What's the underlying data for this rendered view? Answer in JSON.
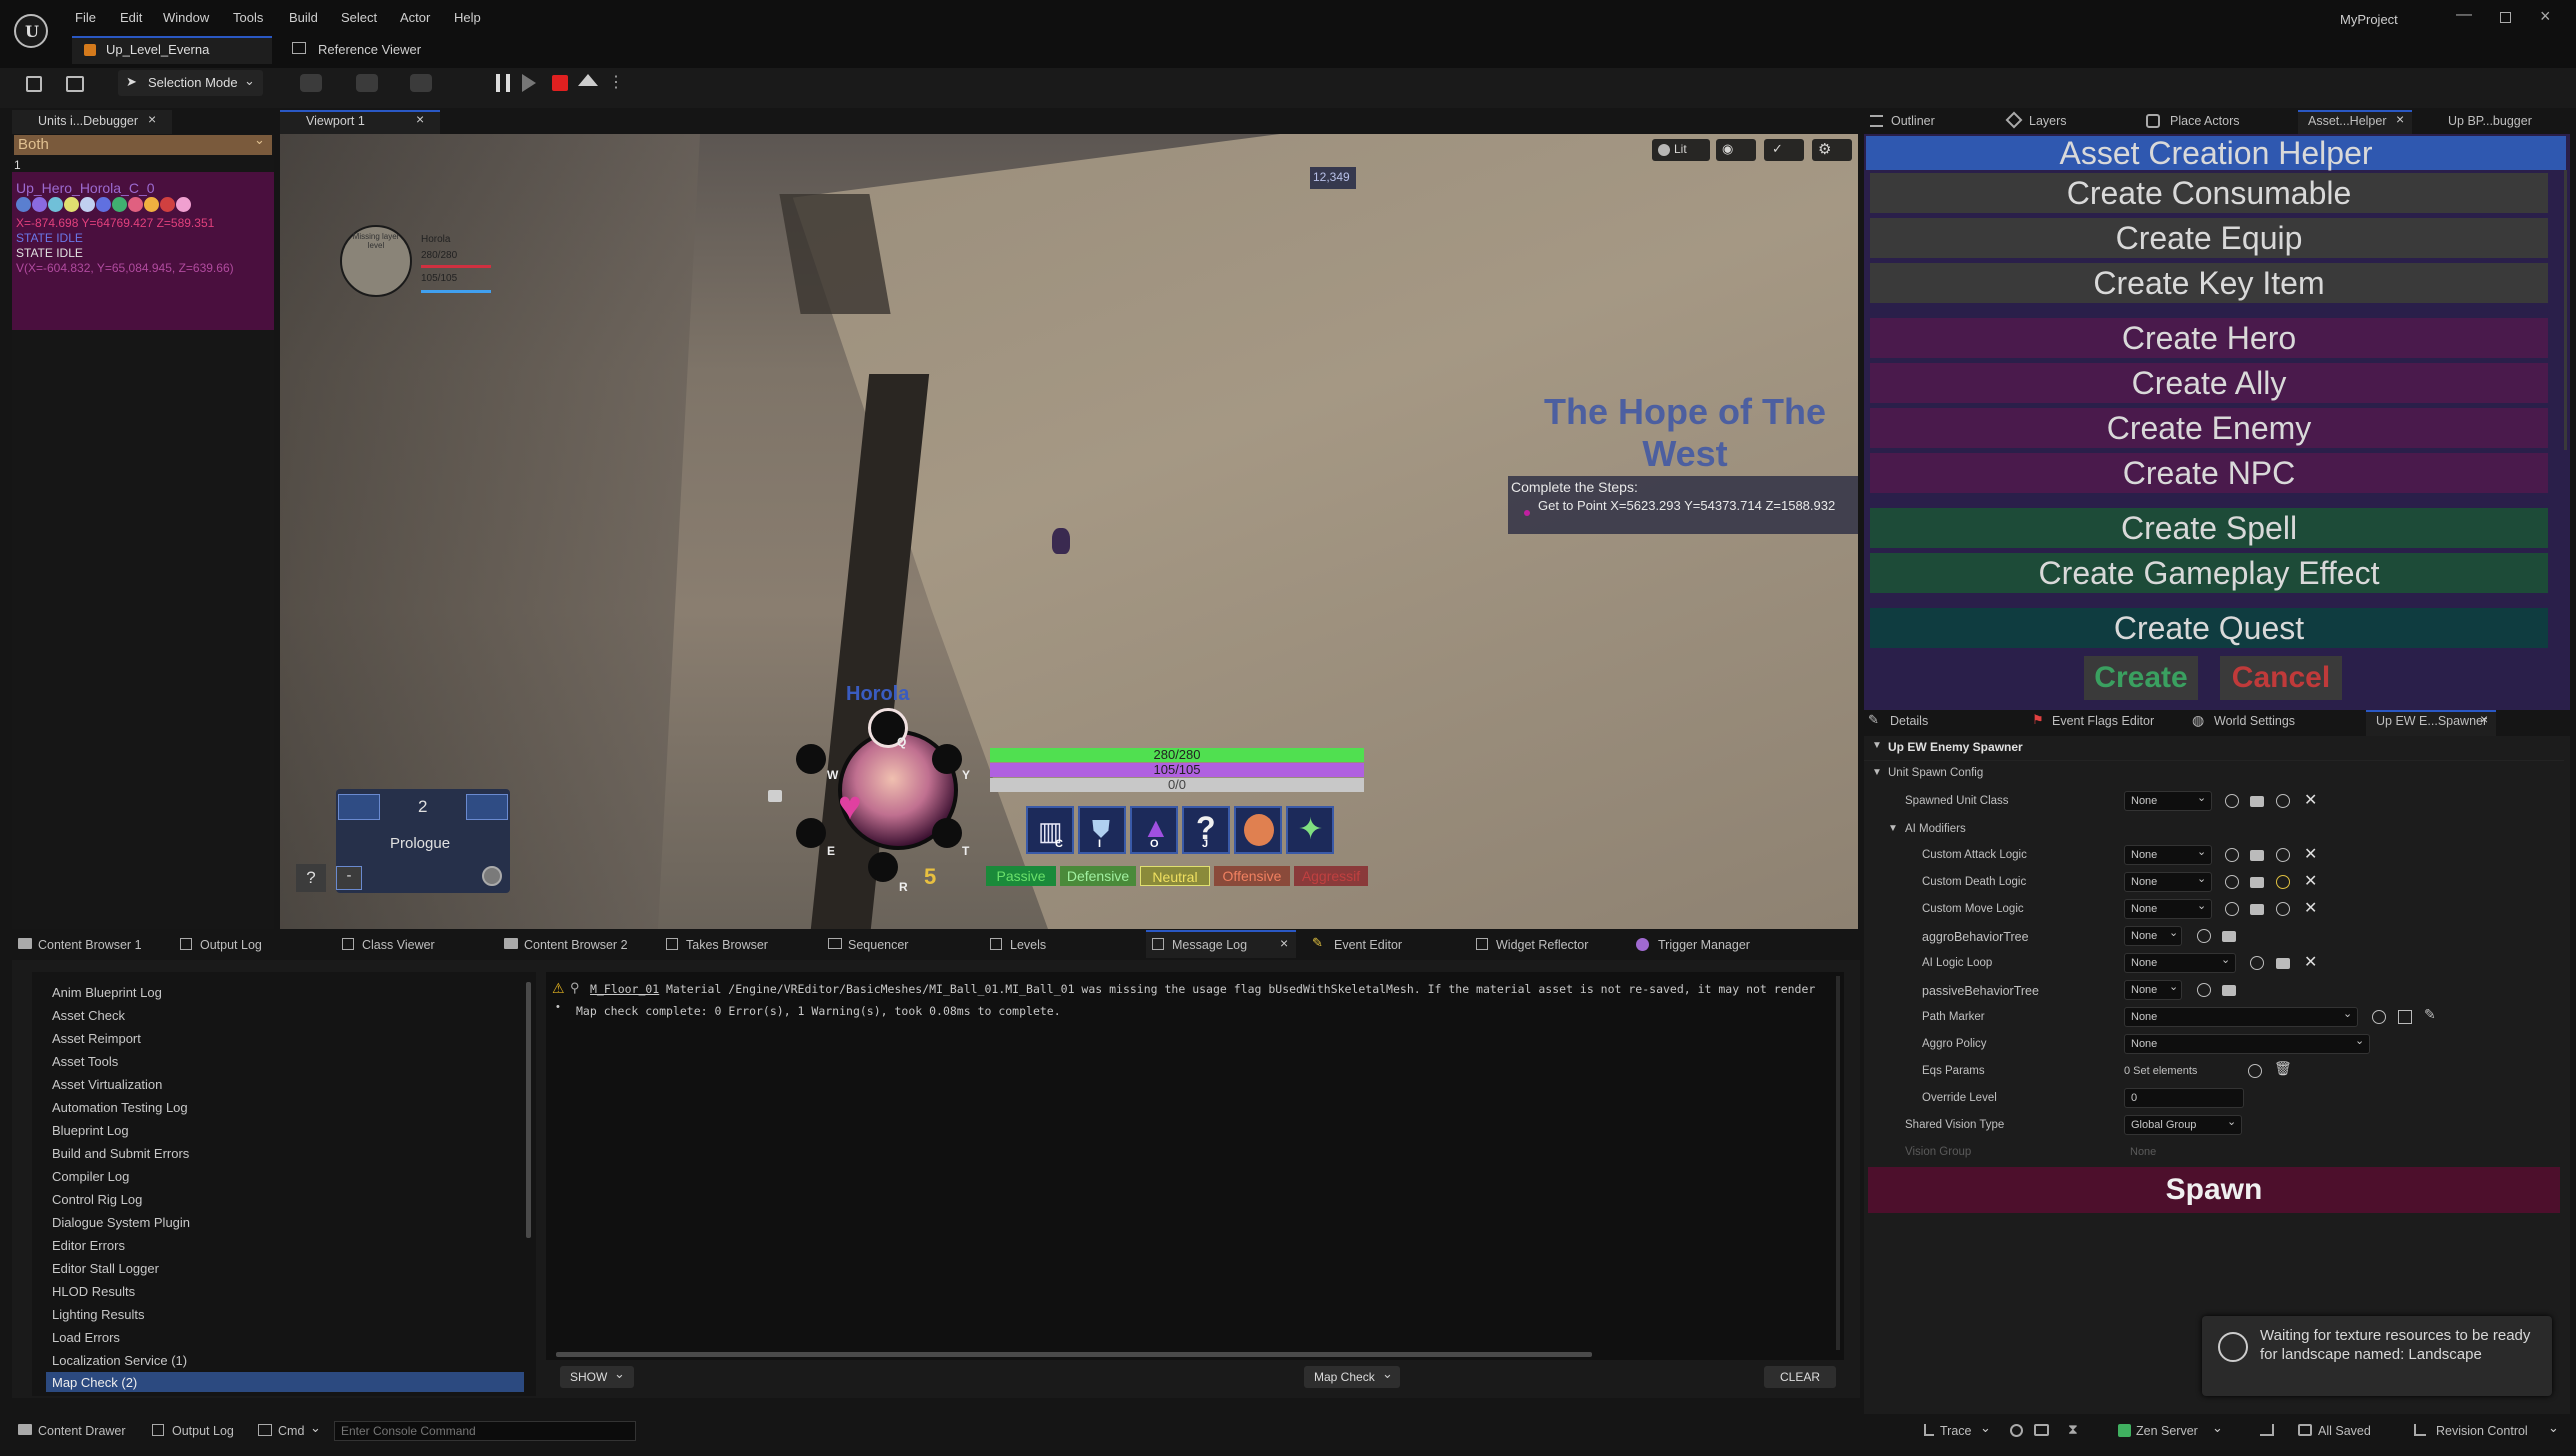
{
  "app": {
    "project_name": "MyProject",
    "level_tab": "Up_Level_Everna",
    "reference_viewer": "Reference Viewer"
  },
  "menu": [
    "File",
    "Edit",
    "Window",
    "Tools",
    "Build",
    "Select",
    "Actor",
    "Help"
  ],
  "toolbar": {
    "selection_mode": "Selection Mode"
  },
  "left_panel": {
    "tab": "Units i...Debugger",
    "filter": "Both",
    "cursor_line": "1",
    "unit_name": "Up_Hero_Horola_C_0",
    "position": "X=-874.698 Y=64769.427 Z=589.351",
    "state1": "STATE IDLE",
    "state2": "STATE IDLE",
    "velocity": "V(X=-604.832, Y=65,084.945, Z=639.66)"
  },
  "viewport": {
    "tab": "Viewport 1",
    "lit": "Lit",
    "distance": "12,349",
    "player_name": "Horola",
    "player_hp": "280/280",
    "player_mp": "105/105",
    "minimap_note": "Missing layer level",
    "quest_title": "The Hope of The West",
    "quest_header": "Complete the Steps:",
    "quest_step": "Get to Point X=5623.293 Y=54373.714 Z=1588.932",
    "hero_label": "Horola",
    "bar_hp": "280/280",
    "bar_mp": "105/105",
    "bar_xp": "0/0",
    "level_number": "5",
    "wheel_keys": [
      "Q",
      "W",
      "Y",
      "E",
      "T",
      "R"
    ],
    "stance_buttons": [
      "Passive",
      "Defensive",
      "Neutral",
      "Offensive",
      "Aggressif"
    ],
    "skill_keys": [
      "C",
      "I",
      "O",
      "J",
      "",
      ""
    ],
    "chapter_number": "2",
    "chapter_name": "Prologue",
    "help_button": "?",
    "minus_button": "-"
  },
  "right_tabs": [
    "Outliner",
    "Layers",
    "Place Actors",
    "Asset...Helper",
    "Up BP...bugger"
  ],
  "asset_helper": {
    "title": "Asset Creation Helper",
    "grey_buttons": [
      "Create Consumable",
      "Create Equip",
      "Create Key Item"
    ],
    "purple_buttons": [
      "Create Hero",
      "Create Ally",
      "Create Enemy",
      "Create NPC"
    ],
    "green_buttons": [
      "Create Spell",
      "Create Gameplay Effect"
    ],
    "teal_buttons": [
      "Create Quest"
    ],
    "create": "Create",
    "cancel": "Cancel"
  },
  "details": {
    "tabs": [
      "Details",
      "Event Flags Editor",
      "World Settings",
      "Up EW E...Spawner"
    ],
    "section": "Up EW Enemy Spawner",
    "subsection": "Unit Spawn Config",
    "spawned_unit_class": "Spawned Unit Class",
    "ai_modifiers": "AI Modifiers",
    "custom_attack": "Custom Attack Logic",
    "custom_death": "Custom Death Logic",
    "custom_move": "Custom Move Logic",
    "aggro_tree": "aggroBehaviorTree",
    "ai_loop": "AI Logic Loop",
    "passive_tree": "passiveBehaviorTree",
    "path_marker": "Path Marker",
    "aggro_policy": "Aggro Policy",
    "eqs_params": "Eqs Params",
    "eqs_value": "0 Set elements",
    "override_level": "Override Level",
    "override_value": "0",
    "shared_vision": "Shared Vision Type",
    "shared_vision_value": "Global Group",
    "vision_group": "Vision Group",
    "none": "None",
    "spawn": "Spawn"
  },
  "bottom_tabs": [
    "Content Browser 1",
    "Output Log",
    "Class Viewer",
    "Content Browser 2",
    "Takes Browser",
    "Sequencer",
    "Levels",
    "Message Log",
    "Event Editor",
    "Widget Reflector",
    "Trigger Manager"
  ],
  "log_categories": [
    "Anim Blueprint Log",
    "Asset Check",
    "Asset Reimport",
    "Asset Tools",
    "Asset Virtualization",
    "Automation Testing Log",
    "Blueprint Log",
    "Build and Submit Errors",
    "Compiler Log",
    "Control Rig Log",
    "Dialogue System Plugin",
    "Editor Errors",
    "Editor Stall Logger",
    "HLOD Results",
    "Lighting Results",
    "Load Errors",
    "Localization Service (1)",
    "Map Check (2)"
  ],
  "log": {
    "link": "M_Floor_01",
    "line1": "Material /Engine/VREditor/BasicMeshes/MI_Ball_01.MI_Ball_01 was missing the usage flag bUsedWithSkeletalMesh. If the material asset is not re-saved, it may not render",
    "line2": "Map check complete: 0 Error(s), 1 Warning(s), took 0.08ms to complete.",
    "show": "SHOW",
    "map_check": "Map Check",
    "clear": "CLEAR"
  },
  "toast": "Waiting for texture resources to be ready for landscape named: Landscape",
  "statusbar": {
    "content_drawer": "Content Drawer",
    "output_log": "Output Log",
    "cmd": "Cmd",
    "console_placeholder": "Enter Console Command",
    "trace": "Trace",
    "zen": "Zen Server",
    "saved": "All Saved",
    "revision": "Revision Control"
  },
  "colors": {
    "accent_blue": "#2a58c4",
    "purple": "#4a1a4c",
    "green": "#1d4b38",
    "teal": "#0f3c40",
    "spawn_bg": "#4d0f2c"
  }
}
